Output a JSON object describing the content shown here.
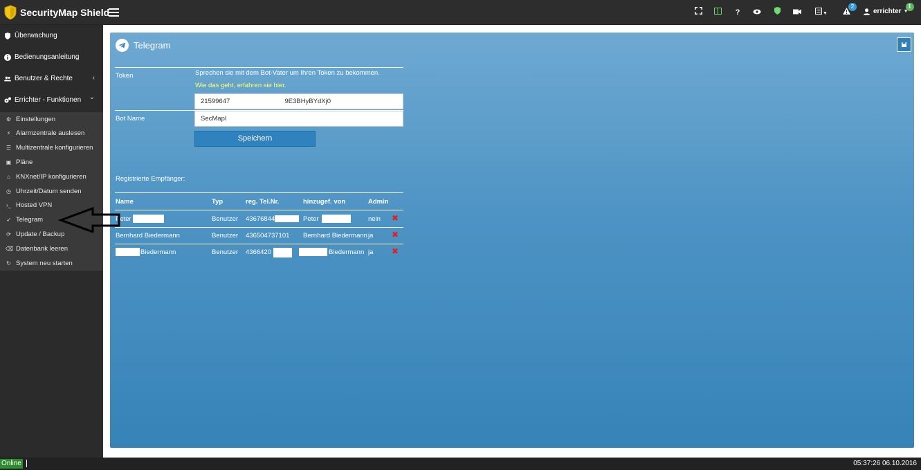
{
  "app": {
    "brand": "SecurityMap Shield",
    "accent": "#3683b8",
    "brand_color": "#f0c419"
  },
  "navbar": {
    "icons": [
      "fullscreen-icon",
      "layout-icon",
      "help-icon",
      "eye-icon",
      "shield-icon",
      "camera-icon",
      "list-icon",
      "warning-icon"
    ],
    "help_glyph": "?",
    "alerts_badge": "2",
    "user_badge": "1",
    "user_name": "errichter"
  },
  "sidebar": {
    "items": [
      {
        "label": "Überwachung",
        "icon": "shield-icon"
      },
      {
        "label": "Bedienungsanleitung",
        "icon": "info-icon"
      },
      {
        "label": "Benutzer & Rechte",
        "icon": "users-icon",
        "chevron": "‹"
      },
      {
        "label": "Errichter - Funktionen",
        "icon": "cogs-icon",
        "chevron": "⌄"
      }
    ],
    "subitems": [
      {
        "label": "Einstellungen",
        "icon": "cogs-icon",
        "glyph": "⚙"
      },
      {
        "label": "Alarmzentrale auslesen",
        "icon": "plug-icon",
        "glyph": "⚡"
      },
      {
        "label": "Multizentrale konfigurieren",
        "icon": "list-icon",
        "glyph": "☰"
      },
      {
        "label": "Pläne",
        "icon": "image-icon",
        "glyph": "▣"
      },
      {
        "label": "KNXnet/IP konfigurieren",
        "icon": "home-icon",
        "glyph": "⌂"
      },
      {
        "label": "Uhrzeit/Datum senden",
        "icon": "clock-icon",
        "glyph": "◷"
      },
      {
        "label": "Hosted VPN",
        "icon": "terminal-icon",
        "glyph": "›_"
      },
      {
        "label": "Telegram",
        "icon": "paper-plane-icon",
        "glyph": "➶"
      },
      {
        "label": "Update / Backup",
        "icon": "refresh-icon",
        "glyph": "⟳"
      },
      {
        "label": "Datenbank leeren",
        "icon": "eraser-icon",
        "glyph": "⌫"
      },
      {
        "label": "System neu starten",
        "icon": "restart-icon",
        "glyph": "↻"
      }
    ]
  },
  "panel": {
    "title": "Telegram",
    "token_label": "Token",
    "token_hint": "Sprechen sie mit dem Bot-Vater um Ihren Token zu bekommen.",
    "token_link": "Wie das geht, erfahren sie hier.",
    "token_value": "21599647                              9E3BHyBYdXj0",
    "bot_name_label": "Bot Name",
    "bot_name_value": "SecMapI",
    "save_button": "Speichern",
    "recipients_label": "Registrierte Empfänger:",
    "table": {
      "headers": [
        "Name",
        "Typ",
        "reg. Tel.Nr.",
        "hinzugef. von",
        "Admin"
      ],
      "rows": [
        {
          "name": "Peter",
          "typ": "Benutzer",
          "tel": "43676844",
          "added_by": "Peter",
          "admin": "nein"
        },
        {
          "name": "Bernhard Biedermann",
          "typ": "Benutzer",
          "tel": "436504737101",
          "added_by": "Bernhard Biedermann",
          "admin": "ja"
        },
        {
          "name": "Biedermann",
          "typ": "Benutzer",
          "tel": "4366420",
          "added_by": "Biedermann",
          "admin": "ja"
        }
      ],
      "delete_glyph": "✖"
    }
  },
  "statusbar": {
    "status": "Online",
    "clock": "05:37:26 06.10.2016"
  }
}
